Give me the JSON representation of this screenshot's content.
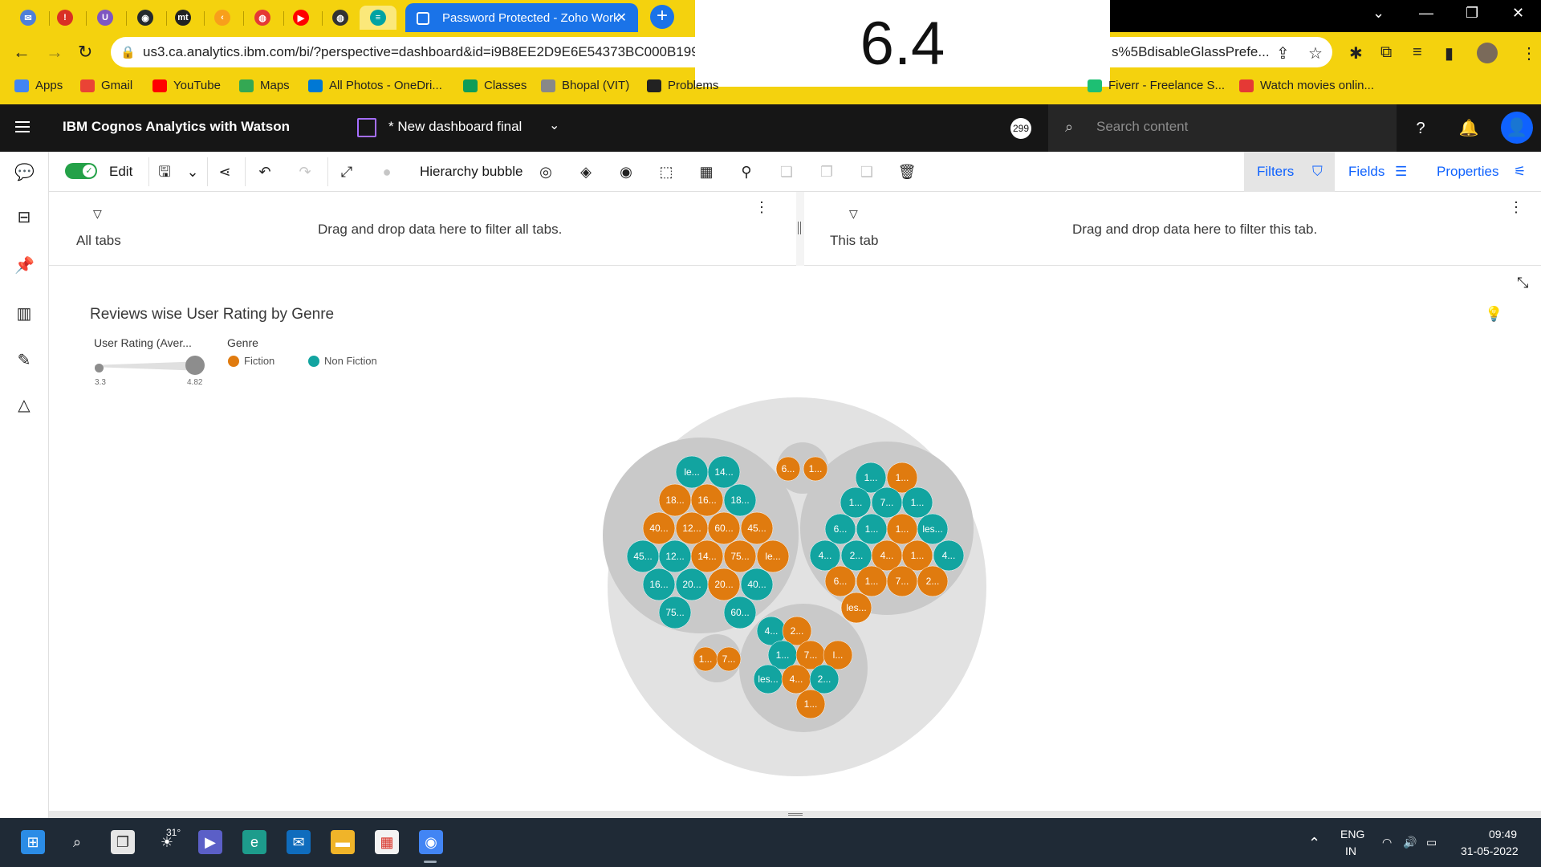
{
  "browser": {
    "tabs": [
      {
        "icon": "mail-icon",
        "color": "#4f7fd9"
      },
      {
        "icon": "alert-icon",
        "color": "#d93025"
      },
      {
        "icon": "u-icon",
        "color": "#7e57c2"
      },
      {
        "icon": "github-icon",
        "color": "#24292e"
      },
      {
        "icon": "mt-icon",
        "color": "#222222"
      },
      {
        "icon": "leetcode-icon",
        "color": "#f89f1b"
      },
      {
        "icon": "paint-icon",
        "color": "#e53935"
      },
      {
        "icon": "youtube-icon",
        "color": "#ff0000"
      },
      {
        "icon": "globe-icon",
        "color": "#333333"
      },
      {
        "icon": "cognos-icon",
        "color": "#00a3a3"
      }
    ],
    "active_tab_title": "Password Protected - Zoho Work",
    "url": "us3.ca.analytics.ibm.com/bi/?perspective=dashboard&id=i9B8EE2D9E6E54373BC000B199",
    "url_tail": "s%5BdisableGlassPrefe...",
    "bookmarks": [
      {
        "label": "Apps",
        "color": "#4285f4"
      },
      {
        "label": "Gmail",
        "color": "#ea4335"
      },
      {
        "label": "YouTube",
        "color": "#ff0000"
      },
      {
        "label": "Maps",
        "color": "#34a853"
      },
      {
        "label": "All Photos - OneDri...",
        "color": "#0078d4"
      },
      {
        "label": "Classes",
        "color": "#0f9d58"
      },
      {
        "label": "Bhopal (VIT)",
        "color": "#888888"
      },
      {
        "label": "Problems",
        "color": "#222222"
      },
      {
        "label": "Fiverr - Freelance S...",
        "color": "#1dbf73"
      },
      {
        "label": "Watch movies onlin...",
        "color": "#e53935"
      }
    ]
  },
  "overlay_value": "6.4",
  "app": {
    "title": "IBM Cognos Analytics with Watson",
    "dashboard_title": "* New dashboard final",
    "badge": "299",
    "search_placeholder": "Search content"
  },
  "toolbar": {
    "edit_label": "Edit",
    "visualization_label": "Hierarchy bubble",
    "filters_label": "Filters",
    "fields_label": "Fields",
    "properties_label": "Properties"
  },
  "filters": {
    "all_tabs_label": "All tabs",
    "all_tabs_hint": "Drag and drop data here to filter all tabs.",
    "this_tab_label": "This tab",
    "this_tab_hint": "Drag and drop data here to filter this tab."
  },
  "widget": {
    "title": "Reviews wise User Rating by Genre",
    "size_legend_title": "User Rating (Aver...",
    "size_min": "3.3",
    "size_max": "4.82",
    "color_legend_title": "Genre",
    "legend": [
      {
        "label": "Fiction",
        "color": "#e07b0f"
      },
      {
        "label": "Non Fiction",
        "color": "#12a4a0"
      }
    ]
  },
  "chart_data": {
    "type": "hierarchy bubble",
    "title": "Reviews wise User Rating by Genre",
    "size_measure": "User Rating (Aver...",
    "size_range": [
      3.3,
      4.82
    ],
    "color_by": "Genre",
    "colors": {
      "Fiction": "#e07b0f",
      "Non Fiction": "#12a4a0"
    },
    "groups": [
      {
        "bubbles": [
          {
            "label": "le...",
            "genre": "Non Fiction"
          },
          {
            "label": "14...",
            "genre": "Non Fiction"
          },
          {
            "label": "18...",
            "genre": "Fiction"
          },
          {
            "label": "16...",
            "genre": "Fiction"
          },
          {
            "label": "18...",
            "genre": "Non Fiction"
          },
          {
            "label": "40...",
            "genre": "Fiction"
          },
          {
            "label": "12...",
            "genre": "Fiction"
          },
          {
            "label": "60...",
            "genre": "Fiction"
          },
          {
            "label": "45...",
            "genre": "Fiction"
          },
          {
            "label": "45...",
            "genre": "Non Fiction"
          },
          {
            "label": "12...",
            "genre": "Non Fiction"
          },
          {
            "label": "14...",
            "genre": "Fiction"
          },
          {
            "label": "75...",
            "genre": "Fiction"
          },
          {
            "label": "le...",
            "genre": "Fiction"
          },
          {
            "label": "16...",
            "genre": "Non Fiction"
          },
          {
            "label": "20...",
            "genre": "Non Fiction"
          },
          {
            "label": "20...",
            "genre": "Fiction"
          },
          {
            "label": "40...",
            "genre": "Non Fiction"
          },
          {
            "label": "75...",
            "genre": "Non Fiction"
          },
          {
            "label": "60...",
            "genre": "Non Fiction"
          }
        ]
      },
      {
        "bubbles": [
          {
            "label": "6...",
            "genre": "Fiction"
          },
          {
            "label": "1...",
            "genre": "Fiction"
          }
        ]
      },
      {
        "bubbles": [
          {
            "label": "1...",
            "genre": "Non Fiction"
          },
          {
            "label": "1...",
            "genre": "Fiction"
          },
          {
            "label": "1...",
            "genre": "Non Fiction"
          },
          {
            "label": "7...",
            "genre": "Non Fiction"
          },
          {
            "label": "1...",
            "genre": "Non Fiction"
          },
          {
            "label": "6...",
            "genre": "Non Fiction"
          },
          {
            "label": "1...",
            "genre": "Non Fiction"
          },
          {
            "label": "1...",
            "genre": "Fiction"
          },
          {
            "label": "les...",
            "genre": "Non Fiction"
          },
          {
            "label": "4...",
            "genre": "Non Fiction"
          },
          {
            "label": "2...",
            "genre": "Non Fiction"
          },
          {
            "label": "4...",
            "genre": "Fiction"
          },
          {
            "label": "1...",
            "genre": "Fiction"
          },
          {
            "label": "4...",
            "genre": "Non Fiction"
          },
          {
            "label": "6...",
            "genre": "Fiction"
          },
          {
            "label": "1...",
            "genre": "Fiction"
          },
          {
            "label": "7...",
            "genre": "Fiction"
          },
          {
            "label": "2...",
            "genre": "Fiction"
          },
          {
            "label": "les...",
            "genre": "Fiction"
          }
        ]
      },
      {
        "bubbles": [
          {
            "label": "1...",
            "genre": "Fiction"
          },
          {
            "label": "7...",
            "genre": "Fiction"
          }
        ]
      },
      {
        "bubbles": [
          {
            "label": "4...",
            "genre": "Non Fiction"
          },
          {
            "label": "2...",
            "genre": "Fiction"
          },
          {
            "label": "1...",
            "genre": "Non Fiction"
          },
          {
            "label": "7...",
            "genre": "Fiction"
          },
          {
            "label": "l...",
            "genre": "Fiction"
          },
          {
            "label": "les...",
            "genre": "Non Fiction"
          },
          {
            "label": "4...",
            "genre": "Fiction"
          },
          {
            "label": "2...",
            "genre": "Non Fiction"
          },
          {
            "label": "1...",
            "genre": "Fiction"
          }
        ]
      }
    ]
  },
  "taskbar": {
    "temperature": "31°",
    "language": "ENG",
    "region": "IN",
    "time": "09:49",
    "date": "31-05-2022"
  }
}
